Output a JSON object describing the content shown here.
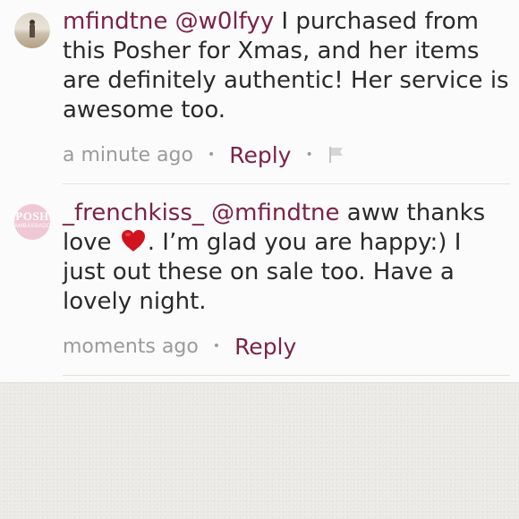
{
  "comments": [
    {
      "username": "mfindtne",
      "mention": "@w0lfyy",
      "text": " I purchased from this Posher for Xmas, and her items are definitely authentic! Her service is awesome too.",
      "timestamp": "a minute ago",
      "separator": "•",
      "reply_label": "Reply",
      "actions": [
        "reply",
        "flag"
      ]
    },
    {
      "username": "_frenchkiss_",
      "mention": "@mfindtne",
      "text_before_emoji": " aww thanks love ",
      "emoji": "red-heart",
      "text_after_emoji": ". I’m glad you are happy:) I just out these on sale too. Have a lovely night.",
      "timestamp": "moments ago",
      "separator": "•",
      "reply_label": "Reply",
      "actions": [
        "reply"
      ],
      "avatar_logo": {
        "top": "POSH",
        "bottom": "AMBASSADOR"
      }
    }
  ],
  "colors": {
    "accent": "#7b2345",
    "muted": "#9b9b9b",
    "body_text": "#2a2a2a",
    "panel_bg": "#fcfbfb",
    "lower_bg": "#ebe9e5",
    "heart": "#d0141e"
  },
  "icons": {
    "flag": "flag-icon",
    "heart": "red-heart-emoji"
  }
}
